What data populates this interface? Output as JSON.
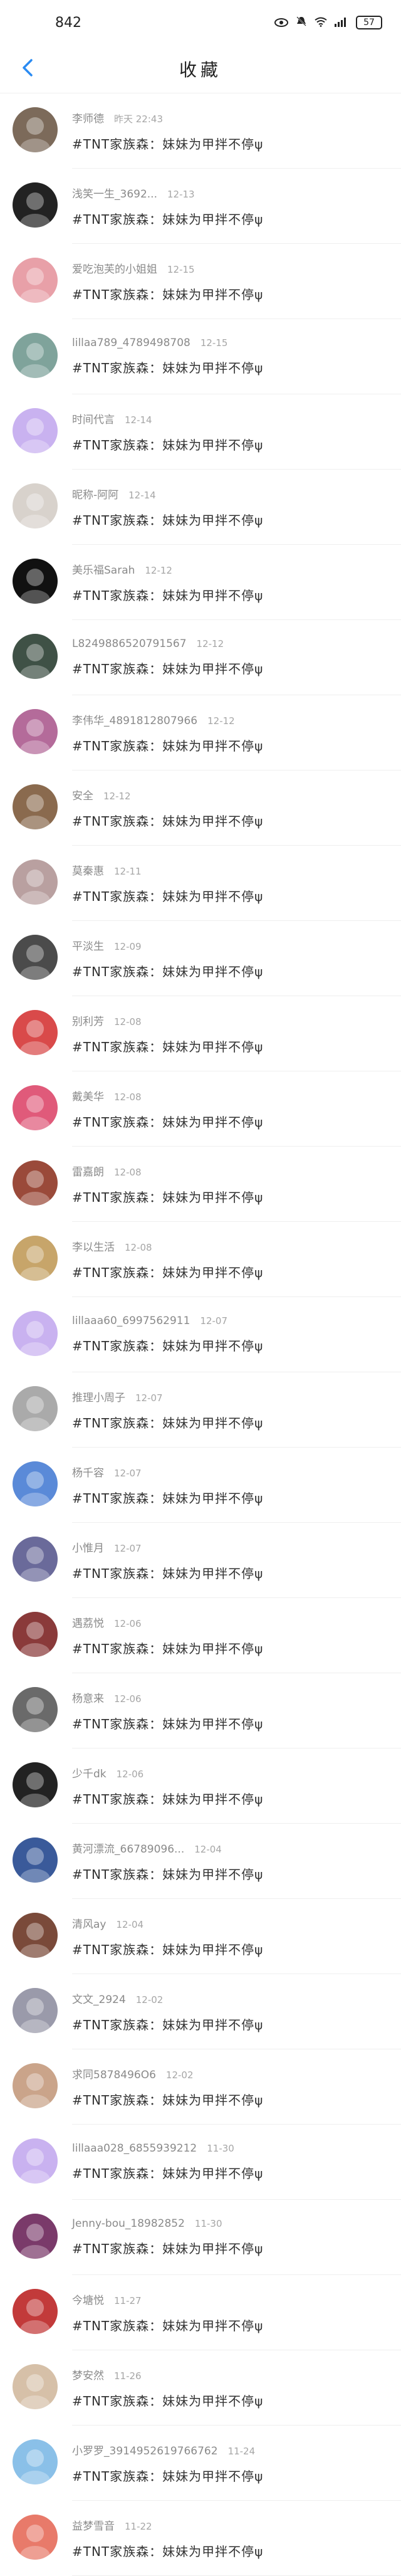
{
  "status_bar": {
    "time": "842",
    "battery": "57"
  },
  "header": {
    "title": "收藏"
  },
  "items": [
    {
      "name": "李师德",
      "time": "昨天 22:43",
      "message": "#TNT家族森：妹妹为甲拌不停ψ",
      "avatar_color": "#7c6a5a"
    },
    {
      "name": "浅笑一生_3692...",
      "time": "12-13",
      "message": "#TNT家族森：妹妹为甲拌不停ψ",
      "avatar_color": "#222222"
    },
    {
      "name": "爱吃泡芙的小姐姐",
      "time": "12-15",
      "message": "#TNT家族森：妹妹为甲拌不停ψ",
      "avatar_color": "#e8a0a8"
    },
    {
      "name": "lillaa789_4789498708",
      "time": "12-15",
      "message": "#TNT家族森：妹妹为甲拌不停ψ",
      "avatar_color": "#7fa39b"
    },
    {
      "name": "时间代言",
      "time": "12-14",
      "message": "#TNT家族森：妹妹为甲拌不停ψ",
      "avatar_color": "#c9b2f0"
    },
    {
      "name": "昵称-阿阿",
      "time": "12-14",
      "message": "#TNT家族森：妹妹为甲拌不停ψ",
      "avatar_color": "#d8d2cc"
    },
    {
      "name": "美乐福Sarah",
      "time": "12-12",
      "message": "#TNT家族森：妹妹为甲拌不停ψ",
      "avatar_color": "#111111"
    },
    {
      "name": "L8249886520791567",
      "time": "12-12",
      "message": "#TNT家族森：妹妹为甲拌不停ψ",
      "avatar_color": "#3f5146"
    },
    {
      "name": "李伟华_4891812807966",
      "time": "12-12",
      "message": "#TNT家族森：妹妹为甲拌不停ψ",
      "avatar_color": "#b46b9a"
    },
    {
      "name": "安全",
      "time": "12-12",
      "message": "#TNT家族森：妹妹为甲拌不停ψ",
      "avatar_color": "#8a6a4e"
    },
    {
      "name": "莫秦惠",
      "time": "12-11",
      "message": "#TNT家族森：妹妹为甲拌不停ψ",
      "avatar_color": "#b9a0a0"
    },
    {
      "name": "平淡生",
      "time": "12-09",
      "message": "#TNT家族森：妹妹为甲拌不停ψ",
      "avatar_color": "#4b4b4b"
    },
    {
      "name": "别利芳",
      "time": "12-08",
      "message": "#TNT家族森：妹妹为甲拌不停ψ",
      "avatar_color": "#d94a4a"
    },
    {
      "name": "戴美华",
      "time": "12-08",
      "message": "#TNT家族森：妹妹为甲拌不停ψ",
      "avatar_color": "#e05a7a"
    },
    {
      "name": "雷嘉朗",
      "time": "12-08",
      "message": "#TNT家族森：妹妹为甲拌不停ψ",
      "avatar_color": "#9a4a3a"
    },
    {
      "name": "李以生活",
      "time": "12-08",
      "message": "#TNT家族森：妹妹为甲拌不停ψ",
      "avatar_color": "#c7a56a"
    },
    {
      "name": "lillaaa60_6997562911",
      "time": "12-07",
      "message": "#TNT家族森：妹妹为甲拌不停ψ",
      "avatar_color": "#c9b2f0"
    },
    {
      "name": "推理小周子",
      "time": "12-07",
      "message": "#TNT家族森：妹妹为甲拌不停ψ",
      "avatar_color": "#aaaaaa"
    },
    {
      "name": "杨千容",
      "time": "12-07",
      "message": "#TNT家族森：妹妹为甲拌不停ψ",
      "avatar_color": "#5a8ad8"
    },
    {
      "name": "小惟月",
      "time": "12-07",
      "message": "#TNT家族森：妹妹为甲拌不停ψ",
      "avatar_color": "#6a6a9a"
    },
    {
      "name": "遇荔悦",
      "time": "12-06",
      "message": "#TNT家族森：妹妹为甲拌不停ψ",
      "avatar_color": "#8a3a3a"
    },
    {
      "name": "杨意来",
      "time": "12-06",
      "message": "#TNT家族森：妹妹为甲拌不停ψ",
      "avatar_color": "#6a6a6a"
    },
    {
      "name": "少千dk",
      "time": "12-06",
      "message": "#TNT家族森：妹妹为甲拌不停ψ",
      "avatar_color": "#222222"
    },
    {
      "name": "黄河漂流_66789096...",
      "time": "12-04",
      "message": "#TNT家族森：妹妹为甲拌不停ψ",
      "avatar_color": "#3a5a9a"
    },
    {
      "name": "清风ay",
      "time": "12-04",
      "message": "#TNT家族森：妹妹为甲拌不停ψ",
      "avatar_color": "#7a4a3a"
    },
    {
      "name": "文文_2924",
      "time": "12-02",
      "message": "#TNT家族森：妹妹为甲拌不停ψ",
      "avatar_color": "#9a9aaa"
    },
    {
      "name": "求同5878496O6",
      "time": "12-02",
      "message": "#TNT家族森：妹妹为甲拌不停ψ",
      "avatar_color": "#caa48a"
    },
    {
      "name": "lillaaa028_6855939212",
      "time": "11-30",
      "message": "#TNT家族森：妹妹为甲拌不停ψ",
      "avatar_color": "#c9b2f0"
    },
    {
      "name": "Jenny-bou_18982852",
      "time": "11-30",
      "message": "#TNT家族森：妹妹为甲拌不停ψ",
      "avatar_color": "#7a3a6a"
    },
    {
      "name": "今塘悦",
      "time": "11-27",
      "message": "#TNT家族森：妹妹为甲拌不停ψ",
      "avatar_color": "#c23a3a"
    },
    {
      "name": "梦安然",
      "time": "11-26",
      "message": "#TNT家族森：妹妹为甲拌不停ψ",
      "avatar_color": "#d6c0a8"
    },
    {
      "name": "小罗罗_3914952619766762",
      "time": "11-24",
      "message": "#TNT家族森：妹妹为甲拌不停ψ",
      "avatar_color": "#8ac0e8"
    },
    {
      "name": "益梦雪音",
      "time": "11-22",
      "message": "#TNT家族森：妹妹为甲拌不停ψ",
      "avatar_color": "#e87a6a"
    }
  ]
}
